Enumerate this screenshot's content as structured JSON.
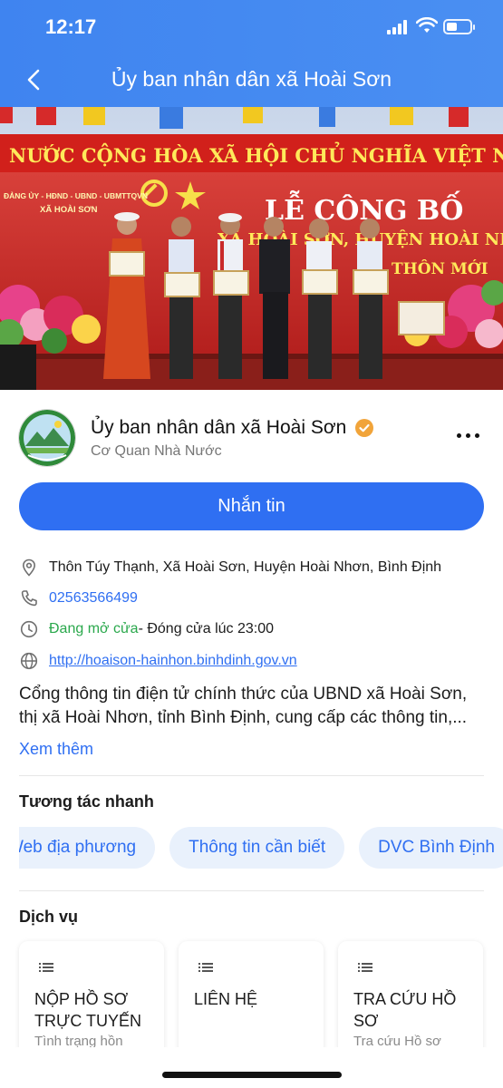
{
  "status_bar": {
    "time": "12:17",
    "battery_level": 0.45
  },
  "header": {
    "title": "Ủy ban nhân dân xã Hoài Sơn"
  },
  "cover": {
    "banner_top": "NƯỚC CỘNG HÒA XÃ HỘI CHỦ NGHĨA VIỆT NAM MUÔN NĂM !",
    "banner_left_1": "ĐẢNG ỦY - HĐND - UBND - UBMTTQVN",
    "banner_left_2": "XÃ HOÀI SƠN",
    "banner_main": "LỄ CÔNG BỐ",
    "banner_line2": "XÃ HOÀI SƠN, HUYỆN HOÀI NHƠN",
    "banner_line3": "THÔN MỚI"
  },
  "profile": {
    "name": "Ủy ban nhân dân xã Hoài Sơn",
    "type": "Cơ Quan Nhà Nước",
    "message_button": "Nhắn tin"
  },
  "info": {
    "address": "Thôn Túy Thạnh, Xã Hoài Sơn, Huyện Hoài Nhơn, Bình Định",
    "phone": "02563566499",
    "open_status": "Đang mở cửa",
    "close_time": " - Đóng cửa lúc 23:00",
    "website": "http://hoaison-hainhon.binhdinh.gov.vn"
  },
  "description": {
    "text": "Cổng thông tin điện tử chính thức của UBND xã Hoài Sơn, thị xã Hoài Nhơn, tỉnh Bình Định, cung cấp các thông tin,...",
    "see_more": "Xem thêm"
  },
  "quick_actions": {
    "title": "Tương tác nhanh",
    "items": [
      "Web địa phương",
      "Thông tin cần biết",
      "DVC Bình Định"
    ]
  },
  "services": {
    "title": "Dịch vụ",
    "cards": [
      {
        "title": "NỘP HỒ SƠ TRỰC TUYẾN",
        "subtitle": "Tình trạng hồn"
      },
      {
        "title": "LIÊN HỆ",
        "subtitle": ""
      },
      {
        "title": "TRA CỨU HỒ SƠ",
        "subtitle": "Tra cứu Hồ sơ"
      }
    ]
  },
  "colors": {
    "header": "#4189f1",
    "primary": "#2f6ff2",
    "open_green": "#2aa84c",
    "chip_bg": "#e9f1fc",
    "verified_orange": "#f1a43a"
  },
  "icons": {
    "back": "chevron-left-icon",
    "verified": "verified-check-icon",
    "more": "more-horizontal-icon",
    "address": "location-pin-icon",
    "phone": "phone-icon",
    "hours": "clock-icon",
    "website": "globe-icon",
    "service": "list-icon"
  }
}
